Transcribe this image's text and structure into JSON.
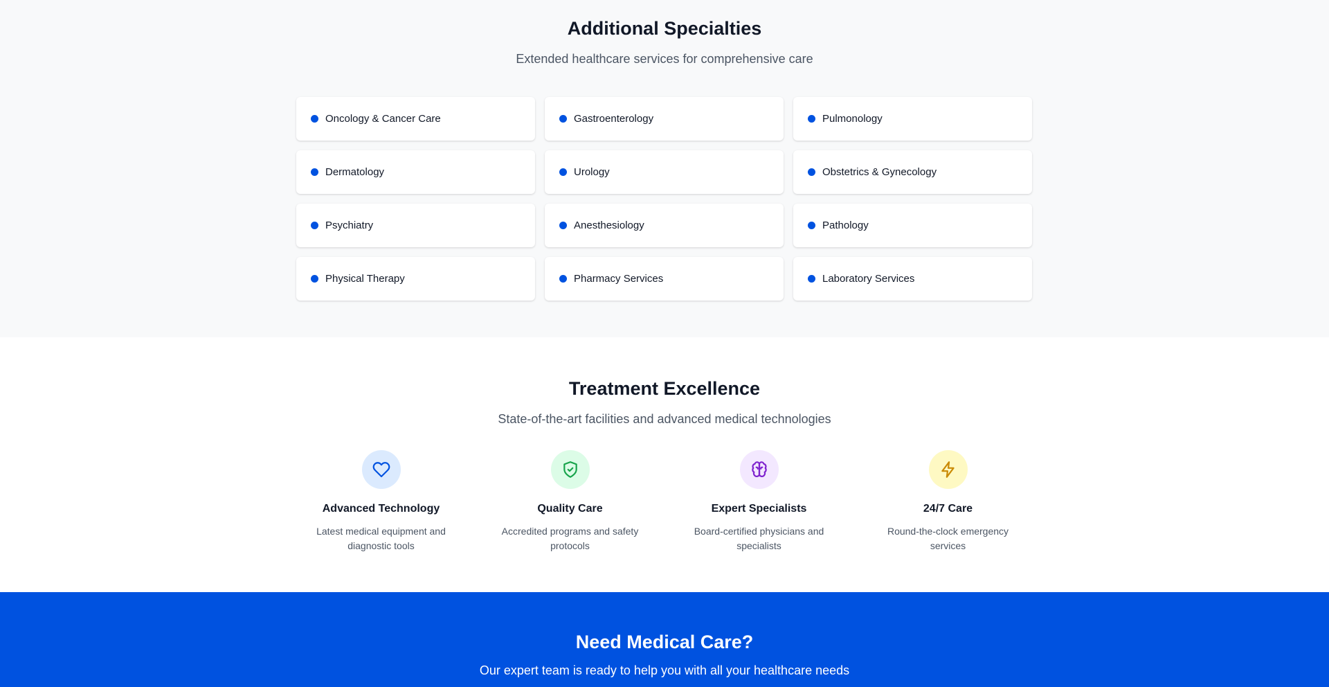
{
  "specialties": {
    "title": "Additional Specialties",
    "subtitle": "Extended healthcare services for comprehensive care",
    "items": [
      "Oncology & Cancer Care",
      "Gastroenterology",
      "Pulmonology",
      "Dermatology",
      "Urology",
      "Obstetrics & Gynecology",
      "Psychiatry",
      "Anesthesiology",
      "Pathology",
      "Physical Therapy",
      "Pharmacy Services",
      "Laboratory Services"
    ],
    "bullet_color": "#0052e0"
  },
  "treatment": {
    "title": "Treatment Excellence",
    "subtitle": "State-of-the-art facilities and advanced medical technologies",
    "features": [
      {
        "icon": "heart-icon",
        "title": "Advanced Technology",
        "description": "Latest medical equipment and diagnostic tools",
        "bg": "#dbeafe",
        "color": "#0052e0"
      },
      {
        "icon": "shield-check-icon",
        "title": "Quality Care",
        "description": "Accredited programs and safety protocols",
        "bg": "#dcfce7",
        "color": "#16a34a"
      },
      {
        "icon": "brain-icon",
        "title": "Expert Specialists",
        "description": "Board-certified physicians and specialists",
        "bg": "#f3e8ff",
        "color": "#7e22ce"
      },
      {
        "icon": "lightning-icon",
        "title": "24/7 Care",
        "description": "Round-the-clock emergency services",
        "bg": "#fef9c3",
        "color": "#ca8a04"
      }
    ]
  },
  "cta": {
    "title": "Need Medical Care?",
    "subtitle": "Our expert team is ready to help you with all your healthcare needs",
    "bg": "#0052e0"
  }
}
